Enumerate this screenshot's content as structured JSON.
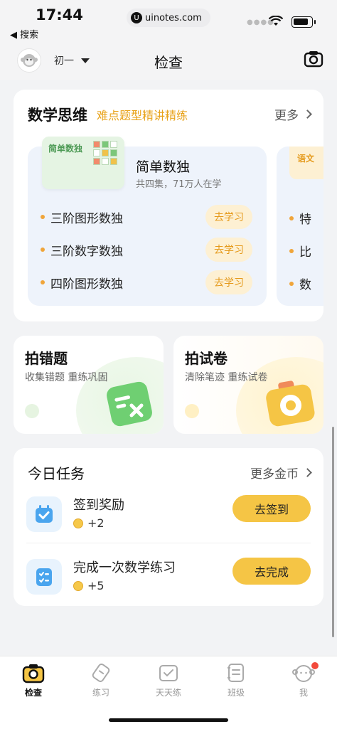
{
  "status_bar": {
    "time": "17:44",
    "back_label": "◀ 搜索",
    "url": "uinotes.com",
    "url_logo": "U"
  },
  "header": {
    "grade": "初一",
    "title": "检查"
  },
  "math_section": {
    "title": "数学思维",
    "subtitle": "难点题型精讲精练",
    "more": "更多",
    "course": {
      "thumb_label": "简单数独",
      "name": "简单数独",
      "meta": "共四集，71万人在学",
      "lessons": [
        {
          "name": "三阶图形数独",
          "button": "去学习"
        },
        {
          "name": "三阶数字数独",
          "button": "去学习"
        },
        {
          "name": "四阶图形数独",
          "button": "去学习"
        }
      ]
    },
    "next_course": {
      "thumb_label": "语文",
      "items": [
        "特",
        "比",
        "数"
      ]
    }
  },
  "features": {
    "wrong": {
      "title": "拍错题",
      "subtitle": "收集错题 重练巩固"
    },
    "paper": {
      "title": "拍试卷",
      "subtitle": "清除笔迹 重练试卷"
    }
  },
  "tasks": {
    "title": "今日任务",
    "more": "更多金币",
    "items": [
      {
        "name": "签到奖励",
        "reward": "+2",
        "button": "去签到",
        "icon": "calendar-check-icon"
      },
      {
        "name": "完成一次数学练习",
        "reward": "+5",
        "button": "去完成",
        "icon": "checklist-icon"
      }
    ]
  },
  "tab_bar": {
    "tabs": [
      {
        "label": "检查",
        "icon": "camera-icon",
        "active": true
      },
      {
        "label": "练习",
        "icon": "pencil-icon",
        "active": false
      },
      {
        "label": "天天练",
        "icon": "daily-check-icon",
        "active": false
      },
      {
        "label": "班级",
        "icon": "class-icon",
        "active": false
      },
      {
        "label": "我",
        "icon": "profile-icon",
        "active": false,
        "badge": true
      }
    ]
  },
  "colors": {
    "accent_yellow": "#f5c545",
    "subtitle_orange": "#e8a31b",
    "badge_red": "#f24a3c"
  }
}
